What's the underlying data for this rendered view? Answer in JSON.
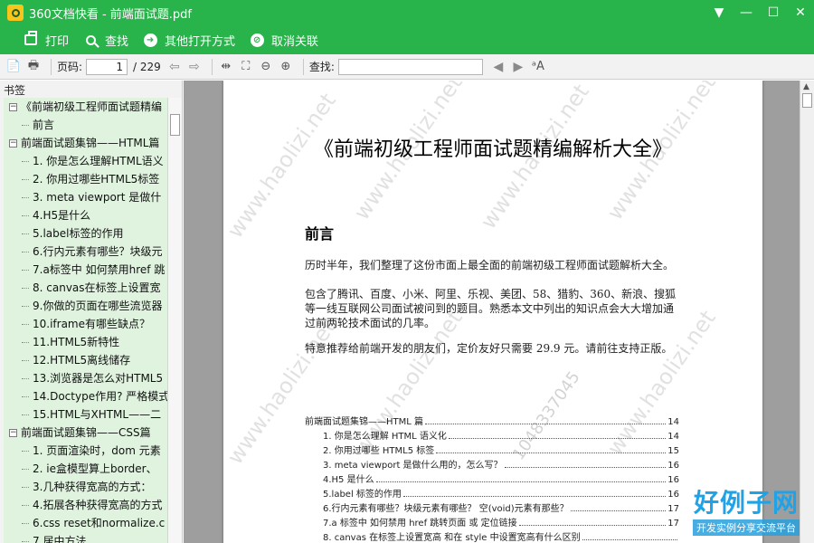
{
  "window": {
    "title": "360文档快看 - 前端面试题.pdf",
    "controls": [
      "▼",
      "—",
      "☐",
      "✕"
    ]
  },
  "actions": [
    {
      "label": "打印",
      "icon": "print-icon"
    },
    {
      "label": "查找",
      "icon": "search-icon"
    },
    {
      "label": "其他打开方式",
      "icon": "open-with-icon"
    },
    {
      "label": "取消关联",
      "icon": "unlink-icon"
    }
  ],
  "toolbar": {
    "page_label": "页码:",
    "page_current": "1",
    "page_total": "/ 229",
    "find_label": "查找:"
  },
  "sidebar": {
    "title": "书签",
    "items": [
      {
        "level": 0,
        "expander": "−",
        "label": "《前端初级工程师面试题精编"
      },
      {
        "level": 1,
        "label": "前言"
      },
      {
        "level": 0,
        "expander": "−",
        "label": "前端面试题集锦——HTML篇"
      },
      {
        "level": 2,
        "label": "1. 你是怎么理解HTML语义"
      },
      {
        "level": 2,
        "label": "2. 你用过哪些HTML5标签"
      },
      {
        "level": 2,
        "label": "3. meta viewport 是做什"
      },
      {
        "level": 2,
        "label": "4.H5是什么"
      },
      {
        "level": 2,
        "label": "5.label标签的作用"
      },
      {
        "level": 2,
        "label": "6.行内元素有哪些？块级元"
      },
      {
        "level": 2,
        "label": "7.a标签中 如何禁用href 跳"
      },
      {
        "level": 2,
        "label": "8. canvas在标签上设置宽"
      },
      {
        "level": 2,
        "label": "9.你做的页面在哪些流览器"
      },
      {
        "level": 2,
        "label": "10.iframe有哪些缺点？"
      },
      {
        "level": 2,
        "label": "11.HTML5新特性"
      },
      {
        "level": 2,
        "label": "12.HTML5离线储存"
      },
      {
        "level": 2,
        "label": "13.浏览器是怎么对HTML5"
      },
      {
        "level": 2,
        "label": "14.Doctype作用? 严格模式"
      },
      {
        "level": 2,
        "label": "15.HTML与XHTML——二"
      },
      {
        "level": 0,
        "expander": "−",
        "label": "前端面试题集锦——CSS篇"
      },
      {
        "level": 2,
        "label": "1. 页面渲染时，dom 元素"
      },
      {
        "level": 2,
        "label": "2. ie盒模型算上border、"
      },
      {
        "level": 2,
        "label": "3.几种获得宽高的方式："
      },
      {
        "level": 2,
        "label": "4.拓展各种获得宽高的方式"
      },
      {
        "level": 2,
        "label": "6.css reset和normalize.c"
      },
      {
        "level": 2,
        "label": "7.居中方法"
      }
    ]
  },
  "page": {
    "title": "《前端初级工程师面试题精编解析大全》",
    "section_heading": "前言",
    "paragraphs": [
      "历时半年，我们整理了这份市面上最全面的前端初级工程师面试题解析大全。",
      "包含了腾讯、百度、小米、阿里、乐视、美团、58、猎豹、360、新浪、搜狐等一线互联网公司面试被问到的题目。熟悉本文中列出的知识点会大大增加通过前两轮技术面试的几率。",
      "特意推荐给前端开发的朋友们，定价友好只需要 29.9 元。请前往支持正版。"
    ],
    "toc": [
      {
        "title": "前端面试题集锦——HTML 篇",
        "page": "14",
        "sub": false
      },
      {
        "title": "1.  你是怎么理解 HTML 语义化",
        "page": "14",
        "sub": true
      },
      {
        "title": "2.  你用过哪些 HTML5 标签",
        "page": "15",
        "sub": true
      },
      {
        "title": "3. meta viewport  是做什么用的，怎么写？",
        "page": "16",
        "sub": true
      },
      {
        "title": "4.H5 是什么",
        "page": "16",
        "sub": true
      },
      {
        "title": "5.label 标签的作用",
        "page": "16",
        "sub": true
      },
      {
        "title": "6.行内元素有哪些？块级元素有哪些？  空(void)元素有那些？",
        "page": "17",
        "sub": true
      },
      {
        "title": "7.a 标签中  如何禁用 href  跳转页面  或  定位链接",
        "page": "17",
        "sub": true
      },
      {
        "title": "8. canvas 在标签上设置宽高  和在 style 中设置宽高有什么区别",
        "page": "",
        "sub": true
      }
    ],
    "watermark": "www.haolizi.net",
    "watermark_number": "1048337045",
    "logo_main": "好例子网",
    "logo_sub": "开发实例分享交流平台"
  },
  "colors": {
    "accent": "#29b34b",
    "tree_bg": "#dff3df"
  }
}
